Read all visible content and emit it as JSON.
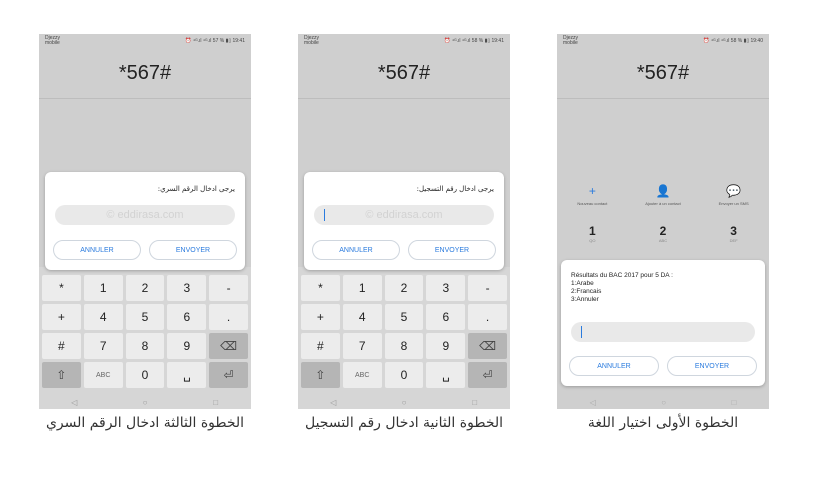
{
  "ussd_code": "*567#",
  "watermark": "© eddirasa.com",
  "buttons": {
    "cancel": "ANNULER",
    "send": "ENVOYER"
  },
  "status": {
    "operator": "Djezzy mobile",
    "p1": "⏰ ⁴ᴳ.ıl ⁴ᴳ.ıl 57 % ▮▯ 19:41",
    "p2": "⏰ ⁴ᴳ.ıl ⁴ᴳ.ıl 58 % ▮▯ 19:41",
    "p3": "⏰ ⁴ᴳ.ıl ⁴ᴳ.ıl 58 % ▮▯ 19:40"
  },
  "step3_prompt": "يرجى ادخال الرقم السري:",
  "step2_prompt": "يرجى ادخال رقم التسجيل:",
  "step1": {
    "actions": [
      {
        "icon": "+",
        "label": "Nouveau contact"
      },
      {
        "icon": "👤",
        "label": "Ajouter à un contact"
      },
      {
        "icon": "💬",
        "label": "Envoyer un SMS"
      }
    ],
    "digits": [
      {
        "n": "1",
        "l": "QO"
      },
      {
        "n": "2",
        "l": "ABC"
      },
      {
        "n": "3",
        "l": "DEF"
      }
    ],
    "message": [
      "Résultats du BAC 2017 pour 5 DA :",
      "1:Arabe",
      "2:Francais",
      "3:Annuler"
    ]
  },
  "keypad": {
    "row1": [
      "*",
      "1",
      "2",
      "3",
      "-"
    ],
    "row2": [
      "+",
      "4",
      "5",
      "6",
      "."
    ],
    "row3": [
      "#",
      "7",
      "8",
      "9",
      "⌫"
    ],
    "row4": [
      "⇧",
      "ABC",
      "0",
      "␣",
      "⏎"
    ]
  },
  "nav": [
    "◁",
    "○",
    "□"
  ],
  "captions": {
    "step3": "الخطوة الثالثة ادخال الرقم السري",
    "step2": "الخطوة الثانية ادخال رقم التسجيل",
    "step1": "الخطوة الأولى اختيار اللغة"
  }
}
